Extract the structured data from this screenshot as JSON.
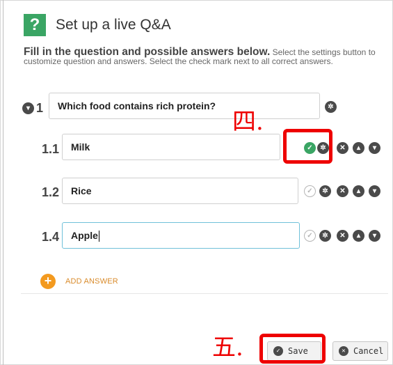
{
  "header": {
    "badge": "?",
    "title": "Set up a live Q&A"
  },
  "instructions": {
    "bold": "Fill in the question and possible answers below.",
    "text": " Select the settings button to customize question and answers. Select the check mark next to all correct answers."
  },
  "question": {
    "number": "1",
    "text": "Which food contains rich protein?"
  },
  "answers": [
    {
      "number": "1.1",
      "text": "Milk",
      "correct": true
    },
    {
      "number": "1.2",
      "text": "Rice",
      "correct": false
    },
    {
      "number": "1.4",
      "text": "Apple",
      "correct": false
    }
  ],
  "add_answer_label": "ADD ANSWER",
  "annotations": {
    "step4": "四.",
    "step5": "五."
  },
  "buttons": {
    "save": "Save",
    "cancel": "Cancel"
  },
  "icons": {
    "circle_down": "chevron-down-icon",
    "settings": "settings-icon",
    "check": "check-icon",
    "remove": "remove-icon",
    "up": "chevron-up-icon",
    "down": "chevron-down-icon",
    "add": "add-icon"
  },
  "colors": {
    "accent": "#3aa564",
    "highlight": "#ee0000",
    "add": "#f39a1f"
  }
}
